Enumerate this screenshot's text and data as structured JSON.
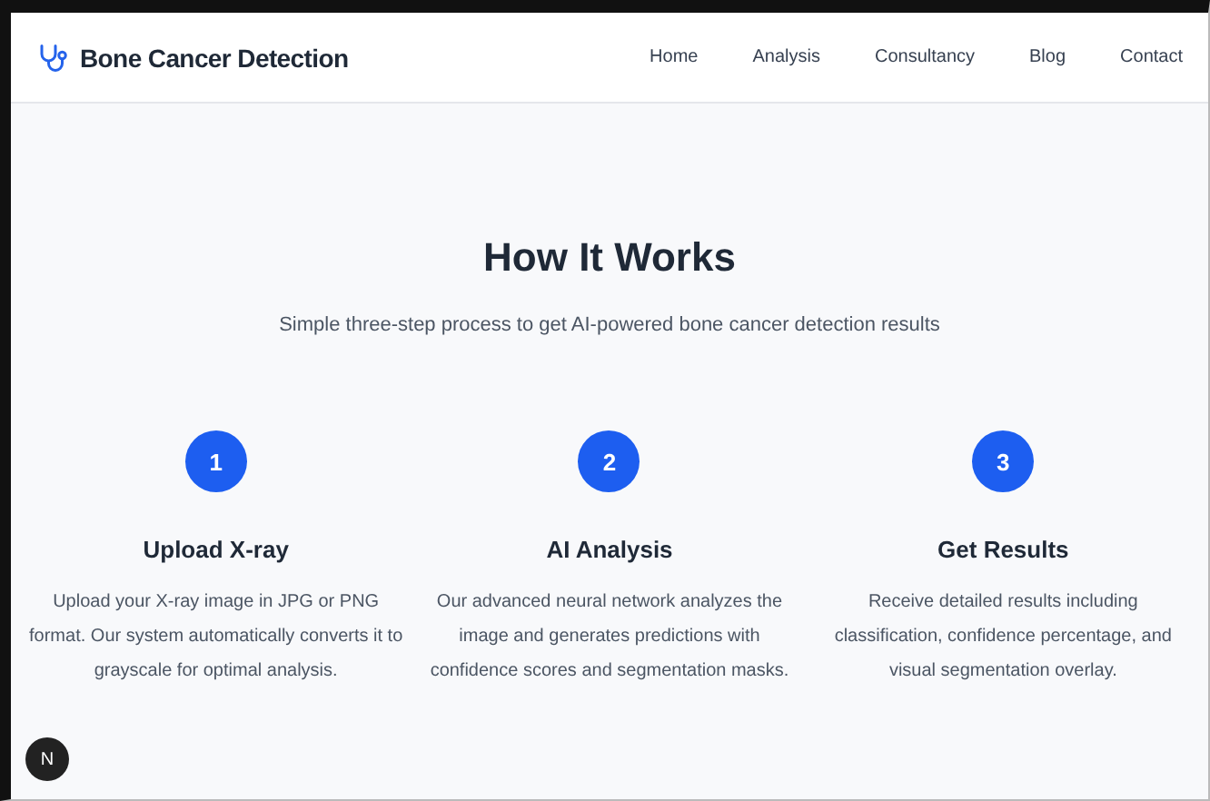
{
  "brand": {
    "title": "Bone Cancer Detection"
  },
  "nav": [
    {
      "label": "Home"
    },
    {
      "label": "Analysis"
    },
    {
      "label": "Consultancy"
    },
    {
      "label": "Blog"
    },
    {
      "label": "Contact"
    }
  ],
  "section": {
    "title": "How It Works",
    "subtitle": "Simple three-step process to get AI-powered bone cancer detection results"
  },
  "steps": [
    {
      "number": "1",
      "title": "Upload X-ray",
      "description": "Upload your X-ray image in JPG or PNG format. Our system automatically converts it to grayscale for optimal analysis."
    },
    {
      "number": "2",
      "title": "AI Analysis",
      "description": "Our advanced neural network analyzes the image and generates predictions with confidence scores and segmentation masks."
    },
    {
      "number": "3",
      "title": "Get Results",
      "description": "Receive detailed results including classification, confidence percentage, and visual segmentation overlay."
    }
  ],
  "dev_badge": {
    "label": "N"
  }
}
